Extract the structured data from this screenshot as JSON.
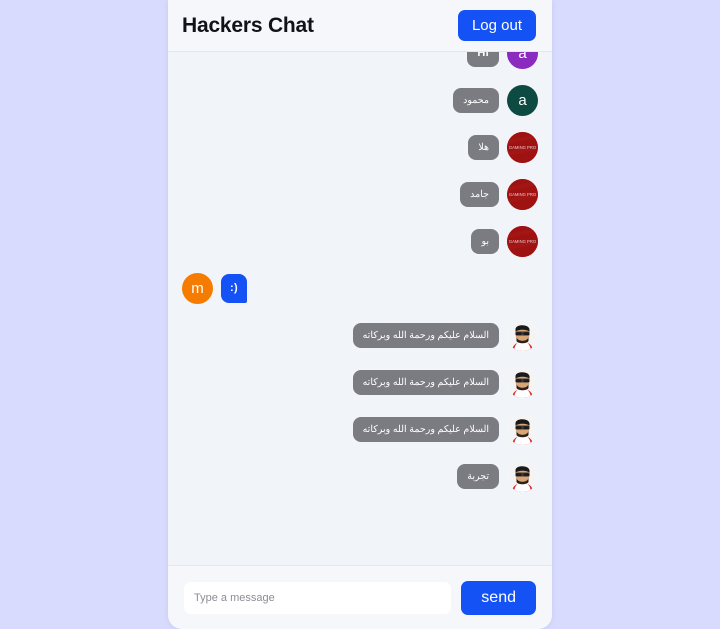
{
  "app": {
    "title": "Hackers Chat",
    "background_color": "#d8dbfe",
    "panel_color": "#f1f4f9",
    "accent_color": "#1452f5",
    "bubble_color": "#7b7b82"
  },
  "header": {
    "title": "Hackers Chat",
    "logout_label": "Log out"
  },
  "messages": [
    {
      "id": "msg-1",
      "side": "right",
      "text": "Hi",
      "script": "latin",
      "avatar": {
        "type": "initial",
        "letter": "a",
        "color": "#8a2abf",
        "name": "avatar-purple-a"
      }
    },
    {
      "id": "msg-2",
      "side": "right",
      "text": "محمود",
      "script": "arabic",
      "avatar": {
        "type": "initial",
        "letter": "a",
        "color": "#0c4a42",
        "name": "avatar-teal-a"
      }
    },
    {
      "id": "msg-3",
      "side": "right",
      "text": "هلا",
      "script": "arabic",
      "avatar": {
        "type": "image",
        "color": "#9e1212",
        "label": "GAMING PRO",
        "name": "avatar-red-logo"
      }
    },
    {
      "id": "msg-4",
      "side": "right",
      "text": "جامد",
      "script": "arabic",
      "avatar": {
        "type": "image",
        "color": "#9e1212",
        "label": "GAMING PRO",
        "name": "avatar-red-logo"
      }
    },
    {
      "id": "msg-5",
      "side": "right",
      "text": "بو",
      "script": "arabic",
      "avatar": {
        "type": "image",
        "color": "#9e1212",
        "label": "GAMING PRO",
        "name": "avatar-red-logo"
      }
    },
    {
      "id": "msg-6",
      "side": "left",
      "text": ":)",
      "script": "latin",
      "bubble_style": "blue",
      "avatar": {
        "type": "initial",
        "letter": "m",
        "color": "#f57c00",
        "name": "avatar-orange-m"
      }
    },
    {
      "id": "msg-7",
      "side": "right",
      "text": "السلام عليكم ورحمة الله وبركاته",
      "script": "arabic",
      "avatar": {
        "type": "photo",
        "name": "avatar-photo-man"
      }
    },
    {
      "id": "msg-8",
      "side": "right",
      "text": "السلام عليكم ورحمة الله وبركاته",
      "script": "arabic",
      "avatar": {
        "type": "photo",
        "name": "avatar-photo-man"
      }
    },
    {
      "id": "msg-9",
      "side": "right",
      "text": "السلام عليكم ورحمة الله وبركاته",
      "script": "arabic",
      "avatar": {
        "type": "photo",
        "name": "avatar-photo-man"
      }
    },
    {
      "id": "msg-10",
      "side": "right",
      "text": "تجربة",
      "script": "arabic",
      "avatar": {
        "type": "photo",
        "name": "avatar-photo-man"
      }
    }
  ],
  "composer": {
    "input_value": "",
    "input_placeholder": "Type a message",
    "send_label": "send"
  }
}
